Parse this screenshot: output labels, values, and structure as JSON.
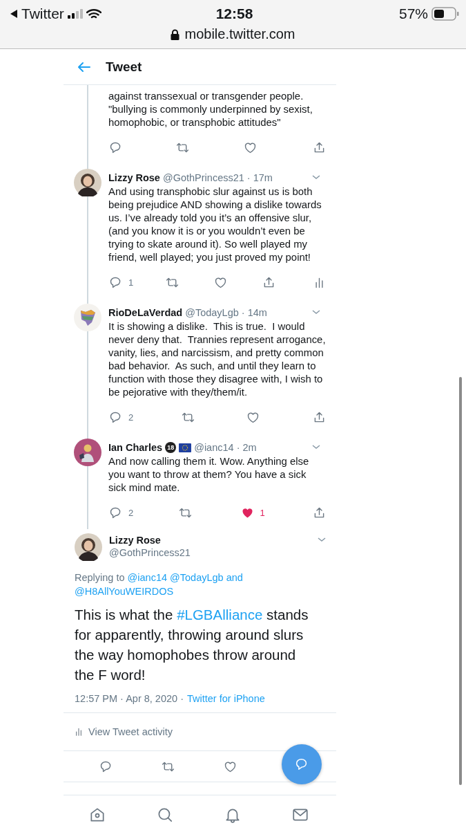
{
  "status_bar": {
    "back_label": "Twitter",
    "time": "12:58",
    "battery": "57%"
  },
  "address_bar": {
    "url": "mobile.twitter.com"
  },
  "header": {
    "title": "Tweet"
  },
  "thread": [
    {
      "kind": "fragment",
      "text": "against transsexual or transgender people. \"bullying is commonly underpinned by sexist, homophobic, or transphobic attitudes\"",
      "actions": [
        {
          "kind": "reply"
        },
        {
          "kind": "retweet"
        },
        {
          "kind": "like",
          "liked": false
        },
        {
          "kind": "share"
        }
      ]
    },
    {
      "kind": "tweet",
      "avatar": {
        "kind": "picture"
      },
      "name": "Lizzy Rose",
      "handle": "@GothPrincess21",
      "time": "· 17m",
      "text": "And using transphobic slur against us is both being prejudice AND showing a dislike towards us. I’ve already told you it’s an offensive slur, (and you know it is or you wouldn’t even be trying to skate around it). So well played my friend, well played; you just proved my point!",
      "actions": [
        {
          "kind": "reply",
          "count": "1"
        },
        {
          "kind": "retweet"
        },
        {
          "kind": "like",
          "liked": false
        },
        {
          "kind": "share"
        },
        {
          "kind": "activity"
        }
      ]
    },
    {
      "kind": "tweet",
      "avatar": {
        "kind": "picture"
      },
      "name": "RioDeLaVerdad",
      "handle": "@TodayLgb",
      "time": "· 14m",
      "text": "It is showing a dislike.  This is true.  I would never deny that.  Trannies represent arrogance, vanity, lies, and narcissism, and pretty common bad behavior.  As such, and until they learn to function with those they disagree with, I wish to be pejorative with they/them/it.",
      "actions": [
        {
          "kind": "reply",
          "count": "2"
        },
        {
          "kind": "retweet"
        },
        {
          "kind": "like",
          "liked": false
        },
        {
          "kind": "share"
        }
      ]
    },
    {
      "kind": "tweet",
      "avatar": {
        "kind": "picture"
      },
      "name": "Ian Charles",
      "badges": [
        {
          "kind": "number",
          "text": "18"
        },
        {
          "kind": "flag"
        }
      ],
      "handle": "@ianc14",
      "time": "· 2m",
      "text": "And now calling them it. Wow. Anything else you want to throw at them? You have a sick sick mind mate.",
      "actions": [
        {
          "kind": "reply",
          "count": "2"
        },
        {
          "kind": "retweet"
        },
        {
          "kind": "like",
          "liked": true,
          "count": "1"
        },
        {
          "kind": "share"
        }
      ]
    }
  ],
  "main_tweet": {
    "avatar": {
      "kind": "picture"
    },
    "name": "Lizzy Rose",
    "handle": "@GothPrincess21",
    "replying_to": [
      {
        "kind": "plain",
        "text": "Replying to"
      },
      {
        "kind": "link",
        "text": "@ianc14"
      },
      {
        "kind": "link",
        "text": "@TodayLgb"
      },
      {
        "kind": "link",
        "text": "and"
      },
      {
        "kind": "link",
        "text": "@H8AllYouWEIRDOS"
      }
    ],
    "text": [
      {
        "kind": "plain",
        "text": "This is what the"
      },
      {
        "kind": "hashtag",
        "text": "#LGBAlliance"
      },
      {
        "kind": "plain",
        "text": "stands for apparently, throwing around slurs the way homophobes throw around the F word!"
      }
    ],
    "timestamp": "12:57 PM · Apr 8, 2020 ·",
    "source": "Twitter for iPhone",
    "activity": "View Tweet activity",
    "actions": [
      {
        "kind": "reply"
      },
      {
        "kind": "retweet"
      },
      {
        "kind": "like",
        "liked": false
      }
    ]
  },
  "compose_button": {
    "kind": "reply"
  },
  "bottom_nav": [
    {
      "kind": "home",
      "selected": false
    },
    {
      "kind": "search",
      "selected": false
    },
    {
      "kind": "notifications",
      "selected": false
    },
    {
      "kind": "messages",
      "selected": false
    }
  ]
}
